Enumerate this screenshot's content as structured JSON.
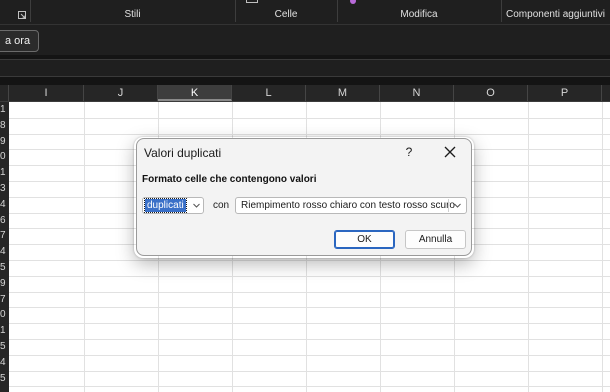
{
  "ribbon": {
    "groups": {
      "stili": "Stili",
      "celle": "Celle",
      "modifica": "Modifica",
      "componenti": "Componenti aggiuntivi"
    },
    "launcher_icon": "dialog-launcher-icon",
    "cells_icon": "cells-insert-icon"
  },
  "notification_bar": {
    "button_label": "a ora"
  },
  "sheet": {
    "columns": [
      "I",
      "J",
      "K",
      "L",
      "M",
      "N",
      "O",
      "P"
    ],
    "selected_column": "K",
    "row_numbers": [
      "1",
      "8",
      "9",
      "0",
      "1",
      "3",
      "4",
      "6",
      "7",
      "4",
      "5",
      "9",
      "7",
      "0",
      "1",
      "5",
      "4",
      "5"
    ]
  },
  "dialog": {
    "title": "Valori duplicati",
    "help_label": "?",
    "close_icon": "close-icon",
    "heading": "Formato celle che contengono valori",
    "type_select_value": "duplicati",
    "con_label": "con",
    "format_select_value": "Riempimento rosso chiaro con testo rosso scuro",
    "ok_label": "OK",
    "cancel_label": "Annulla"
  },
  "colors": {
    "ribbon_bg": "#1f1f1f",
    "dialog_bg": "#f3f3f3",
    "accent": "#2a66c0",
    "selection": "#3a70c8"
  }
}
